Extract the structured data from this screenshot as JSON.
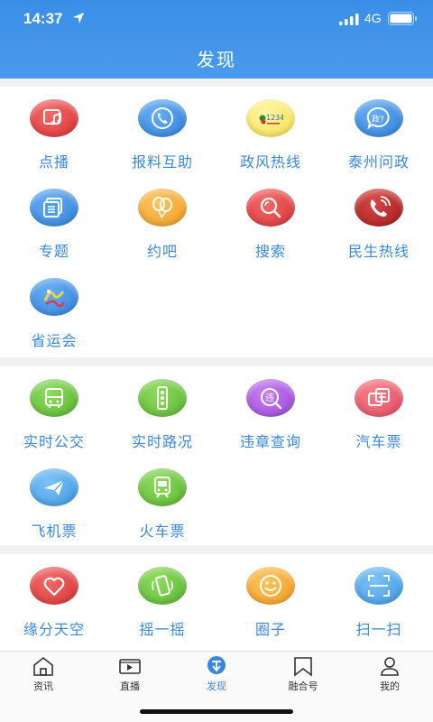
{
  "status": {
    "time": "14:37",
    "network": "4G"
  },
  "header": {
    "title": "发现"
  },
  "sections": [
    {
      "items": [
        {
          "label": "点播",
          "icon": "video-note-icon",
          "color": "#e03a3a"
        },
        {
          "label": "报料互助",
          "icon": "phone-icon",
          "color": "#3b8ee3"
        },
        {
          "label": "政风热线",
          "icon": "hotline-12345-icon",
          "color": "#f6df4a",
          "icon_text": "12345"
        },
        {
          "label": "泰州问政",
          "icon": "question-bubble-icon",
          "color": "#3b8ee3",
          "icon_text": "政?"
        },
        {
          "label": "专题",
          "icon": "stacked-cards-icon",
          "color": "#3b8ee3"
        },
        {
          "label": "约吧",
          "icon": "balloons-icon",
          "color": "#f3a124"
        },
        {
          "label": "搜索",
          "icon": "search-icon",
          "color": "#e03a3a"
        },
        {
          "label": "民生热线",
          "icon": "phone-ringing-icon",
          "color": "#b02121"
        },
        {
          "label": "省运会",
          "icon": "games-logo-icon",
          "color": "#3b8ee3"
        }
      ]
    },
    {
      "items": [
        {
          "label": "实时公交",
          "icon": "bus-icon",
          "color": "#5cb830"
        },
        {
          "label": "实时路况",
          "icon": "traffic-light-icon",
          "color": "#5cb830"
        },
        {
          "label": "违章查询",
          "icon": "violation-search-icon",
          "color": "#9f4adb",
          "icon_text": "违"
        },
        {
          "label": "汽车票",
          "icon": "bus-ticket-icon",
          "color": "#e5505f"
        },
        {
          "label": "飞机票",
          "icon": "airplane-icon",
          "color": "#3e97e2"
        },
        {
          "label": "火车票",
          "icon": "train-icon",
          "color": "#5cb830"
        }
      ]
    },
    {
      "items": [
        {
          "label": "缘分天空",
          "icon": "heart-icon",
          "color": "#e03a3a"
        },
        {
          "label": "摇一摇",
          "icon": "shake-phone-icon",
          "color": "#5cb830"
        },
        {
          "label": "圈子",
          "icon": "smiley-icon",
          "color": "#f3a124"
        },
        {
          "label": "扫一扫",
          "icon": "scan-icon",
          "color": "#3e97e2"
        }
      ]
    }
  ],
  "tabs": [
    {
      "label": "资讯",
      "icon": "home-icon"
    },
    {
      "label": "直播",
      "icon": "live-tv-icon"
    },
    {
      "label": "发现",
      "icon": "discover-icon",
      "active": true
    },
    {
      "label": "融合号",
      "icon": "bookmark-icon"
    },
    {
      "label": "我的",
      "icon": "user-icon"
    }
  ]
}
